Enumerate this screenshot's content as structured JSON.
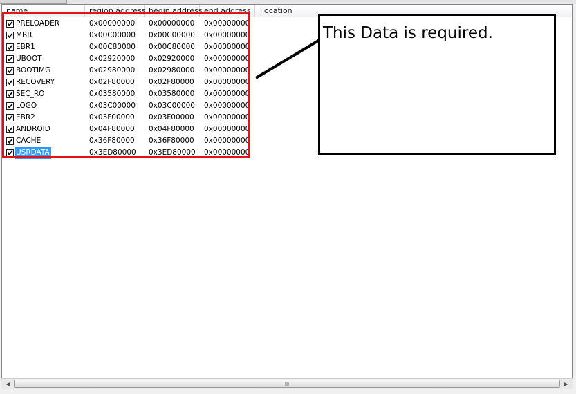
{
  "columns": [
    {
      "label": "name"
    },
    {
      "label": "region address"
    },
    {
      "label": "begin address"
    },
    {
      "label": "end address"
    },
    {
      "label": "location"
    }
  ],
  "rows": [
    {
      "name": "PRELOADER",
      "region": "0x00000000",
      "begin": "0x00000000",
      "end": "0x00000000",
      "checked": true,
      "selected": false
    },
    {
      "name": "MBR",
      "region": "0x00C00000",
      "begin": "0x00C00000",
      "end": "0x00000000",
      "checked": true,
      "selected": false
    },
    {
      "name": "EBR1",
      "region": "0x00C80000",
      "begin": "0x00C80000",
      "end": "0x00000000",
      "checked": true,
      "selected": false
    },
    {
      "name": "UBOOT",
      "region": "0x02920000",
      "begin": "0x02920000",
      "end": "0x00000000",
      "checked": true,
      "selected": false
    },
    {
      "name": "BOOTIMG",
      "region": "0x02980000",
      "begin": "0x02980000",
      "end": "0x00000000",
      "checked": true,
      "selected": false
    },
    {
      "name": "RECOVERY",
      "region": "0x02F80000",
      "begin": "0x02F80000",
      "end": "0x00000000",
      "checked": true,
      "selected": false
    },
    {
      "name": "SEC_RO",
      "region": "0x03580000",
      "begin": "0x03580000",
      "end": "0x00000000",
      "checked": true,
      "selected": false
    },
    {
      "name": "LOGO",
      "region": "0x03C00000",
      "begin": "0x03C00000",
      "end": "0x00000000",
      "checked": true,
      "selected": false
    },
    {
      "name": "EBR2",
      "region": "0x03F00000",
      "begin": "0x03F00000",
      "end": "0x00000000",
      "checked": true,
      "selected": false
    },
    {
      "name": "ANDROID",
      "region": "0x04F80000",
      "begin": "0x04F80000",
      "end": "0x00000000",
      "checked": true,
      "selected": false
    },
    {
      "name": "CACHE",
      "region": "0x36F80000",
      "begin": "0x36F80000",
      "end": "0x00000000",
      "checked": true,
      "selected": false
    },
    {
      "name": "USRDATA",
      "region": "0x3ED80000",
      "begin": "0x3ED80000",
      "end": "0x00000000",
      "checked": true,
      "selected": true
    }
  ],
  "annotation": {
    "text": "This Data is required.",
    "highlight_color": "#e3131b",
    "box_color": "#000000"
  },
  "scrollbar": {
    "left_icon": "arrow-left-icon",
    "right_icon": "arrow-right-icon",
    "grip": "III"
  },
  "colors": {
    "selection": "#3399ff"
  }
}
